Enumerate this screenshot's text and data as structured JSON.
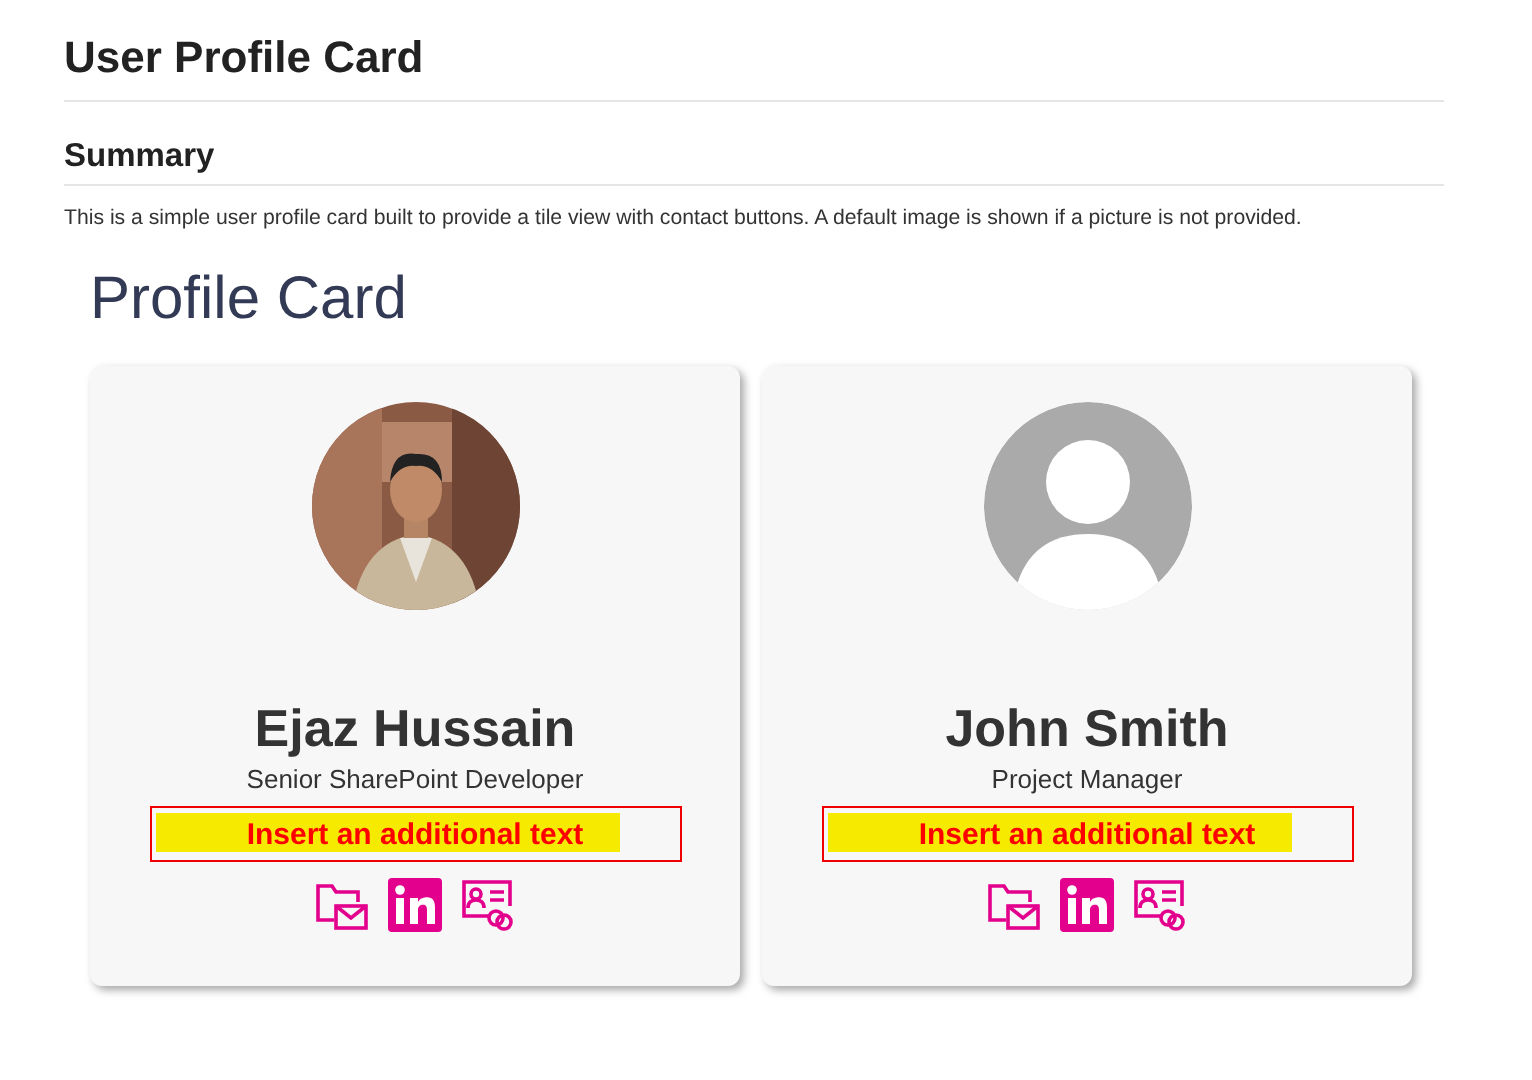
{
  "page_title": "User Profile Card",
  "summary": {
    "heading": "Summary",
    "text": "This is a simple user profile card built to provide a tile view with contact buttons. A default image is shown if a picture is not provided."
  },
  "section_title": "Profile Card",
  "cards": [
    {
      "name": "Ejaz Hussain",
      "job_title": "Senior SharePoint Developer",
      "note": "Insert an additional text"
    },
    {
      "kind": "default",
      "name": "John Smith",
      "job_title": "Project Manager",
      "note": "Insert an additional text"
    }
  ]
}
